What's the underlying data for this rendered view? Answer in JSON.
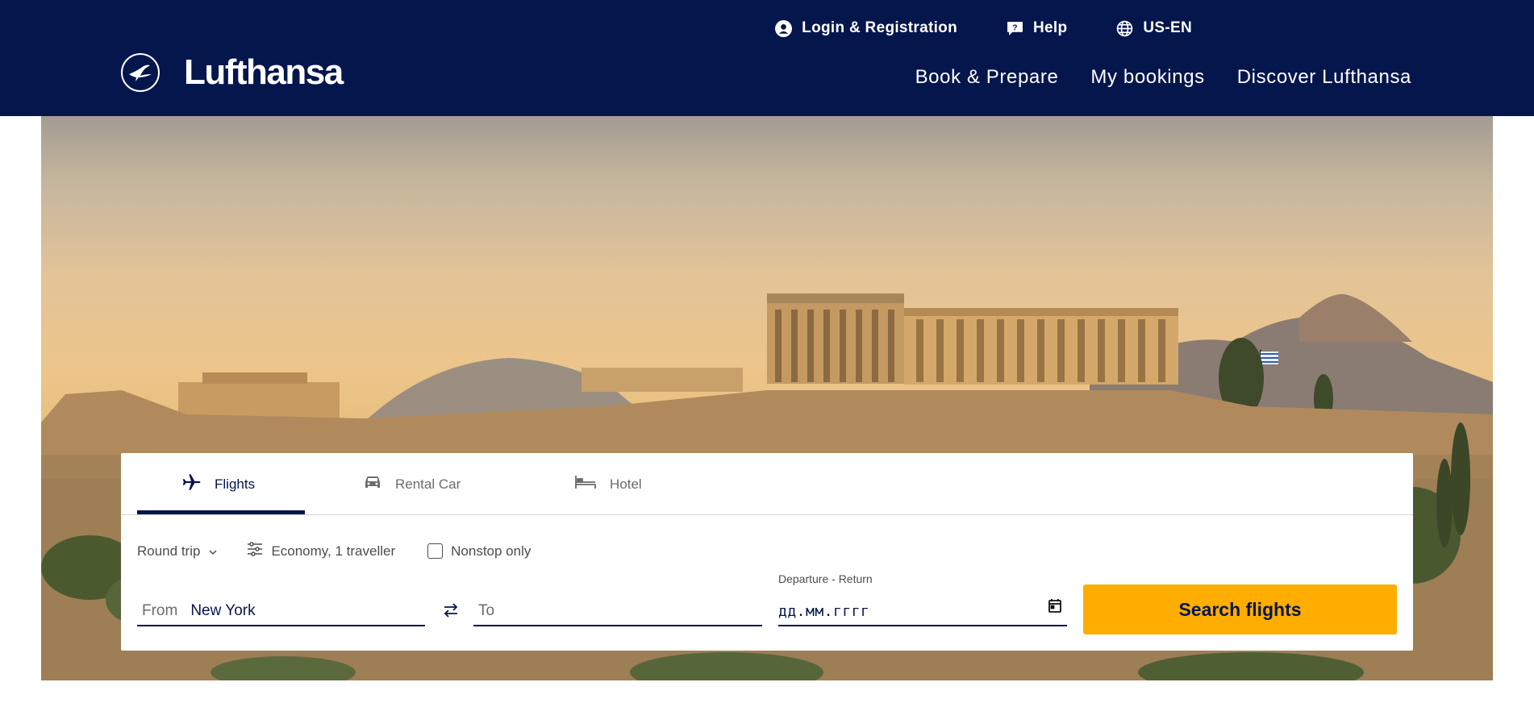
{
  "brand": {
    "name": "Lufthansa",
    "logo_icon": "crane-logo-icon"
  },
  "colors": {
    "header_bg": "#05164d",
    "accent": "#ffad00",
    "text_primary": "#05164d"
  },
  "top_links": [
    {
      "label": "Login & Registration",
      "icon": "user-circle-icon"
    },
    {
      "label": "Help",
      "icon": "chat-help-icon"
    },
    {
      "label": "US-EN",
      "icon": "globe-icon"
    }
  ],
  "main_nav": [
    {
      "label": "Book & Prepare"
    },
    {
      "label": "My bookings"
    },
    {
      "label": "Discover Lufthansa"
    }
  ],
  "booking": {
    "tabs": [
      {
        "label": "Flights",
        "icon": "airplane-icon",
        "active": true
      },
      {
        "label": "Rental Car",
        "icon": "car-icon",
        "active": false
      },
      {
        "label": "Hotel",
        "icon": "bed-icon",
        "active": false
      }
    ],
    "trip_type": "Round trip",
    "cabin_travellers": "Economy, 1 traveller",
    "nonstop_label": "Nonstop only",
    "nonstop_checked": false,
    "from": {
      "label": "From",
      "value": "New York"
    },
    "to": {
      "label": "To",
      "value": ""
    },
    "dates": {
      "caption": "Departure - Return",
      "value": "дд.мм.гггг"
    },
    "search_label": "Search flights"
  }
}
